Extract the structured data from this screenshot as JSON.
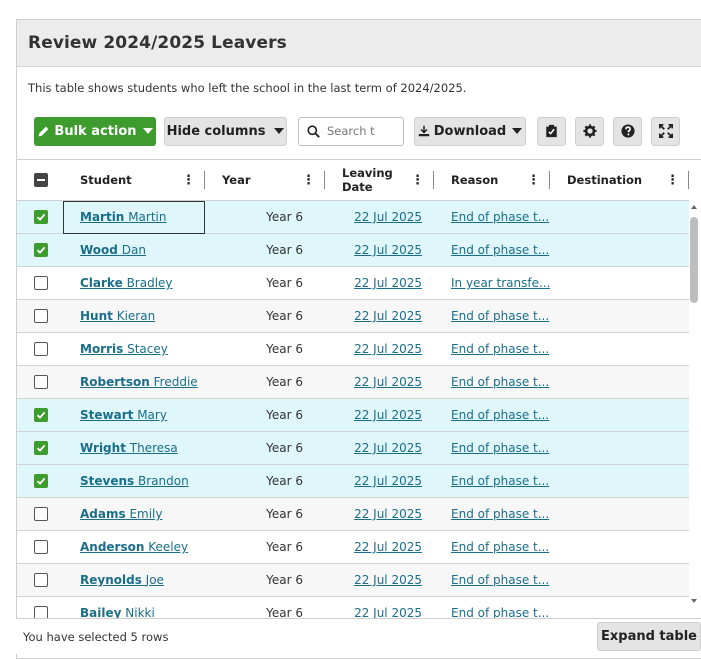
{
  "panel": {
    "title": "Review 2024/2025 Leavers",
    "description": "This table shows students who left the school in the last term of 2024/2025."
  },
  "toolbar": {
    "bulk_action_label": "Bulk action",
    "hide_columns_label": "Hide columns",
    "search_placeholder": "Search t",
    "download_label": "Download",
    "bulk_action_color": "#3e9b2d"
  },
  "table": {
    "columns": [
      {
        "label": "Student"
      },
      {
        "label": "Year"
      },
      {
        "label": "Leaving Date"
      },
      {
        "label": "Reason"
      },
      {
        "label": "Destination"
      }
    ],
    "rows": [
      {
        "selected": true,
        "surname": "Martin",
        "forename": "Martin",
        "year": "Year 6",
        "leaving_date": "22 Jul 2025",
        "reason": "End of phase t...",
        "destination": ""
      },
      {
        "selected": true,
        "surname": "Wood",
        "forename": "Dan",
        "year": "Year 6",
        "leaving_date": "22 Jul 2025",
        "reason": "End of phase t...",
        "destination": ""
      },
      {
        "selected": false,
        "surname": "Clarke",
        "forename": "Bradley",
        "year": "Year 6",
        "leaving_date": "22 Jul 2025",
        "reason": "In year transfe...",
        "destination": ""
      },
      {
        "selected": false,
        "surname": "Hunt",
        "forename": "Kieran",
        "year": "Year 6",
        "leaving_date": "22 Jul 2025",
        "reason": "End of phase t...",
        "destination": ""
      },
      {
        "selected": false,
        "surname": "Morris",
        "forename": "Stacey",
        "year": "Year 6",
        "leaving_date": "22 Jul 2025",
        "reason": "End of phase t...",
        "destination": ""
      },
      {
        "selected": false,
        "surname": "Robertson",
        "forename": "Freddie",
        "year": "Year 6",
        "leaving_date": "22 Jul 2025",
        "reason": "End of phase t...",
        "destination": ""
      },
      {
        "selected": true,
        "surname": "Stewart",
        "forename": "Mary",
        "year": "Year 6",
        "leaving_date": "22 Jul 2025",
        "reason": "End of phase t...",
        "destination": ""
      },
      {
        "selected": true,
        "surname": "Wright",
        "forename": "Theresa",
        "year": "Year 6",
        "leaving_date": "22 Jul 2025",
        "reason": "End of phase t...",
        "destination": ""
      },
      {
        "selected": true,
        "surname": "Stevens",
        "forename": "Brandon",
        "year": "Year 6",
        "leaving_date": "22 Jul 2025",
        "reason": "End of phase t...",
        "destination": ""
      },
      {
        "selected": false,
        "surname": "Adams",
        "forename": "Emily",
        "year": "Year 6",
        "leaving_date": "22 Jul 2025",
        "reason": "End of phase t...",
        "destination": ""
      },
      {
        "selected": false,
        "surname": "Anderson",
        "forename": "Keeley",
        "year": "Year 6",
        "leaving_date": "22 Jul 2025",
        "reason": "End of phase t...",
        "destination": ""
      },
      {
        "selected": false,
        "surname": "Reynolds",
        "forename": "Joe",
        "year": "Year 6",
        "leaving_date": "22 Jul 2025",
        "reason": "End of phase t...",
        "destination": ""
      },
      {
        "selected": false,
        "surname": "Bailey",
        "forename": "Nikki",
        "year": "Year 6",
        "leaving_date": "22 Jul 2025",
        "reason": "End of phase t...",
        "destination": ""
      }
    ]
  },
  "footer": {
    "status_text": "You have selected 5 rows",
    "expand_label": "Expand table"
  },
  "colors": {
    "selected_row": "#dff6fa",
    "link": "#1a6e8a",
    "checkbox_checked": "#3e9b2d"
  }
}
